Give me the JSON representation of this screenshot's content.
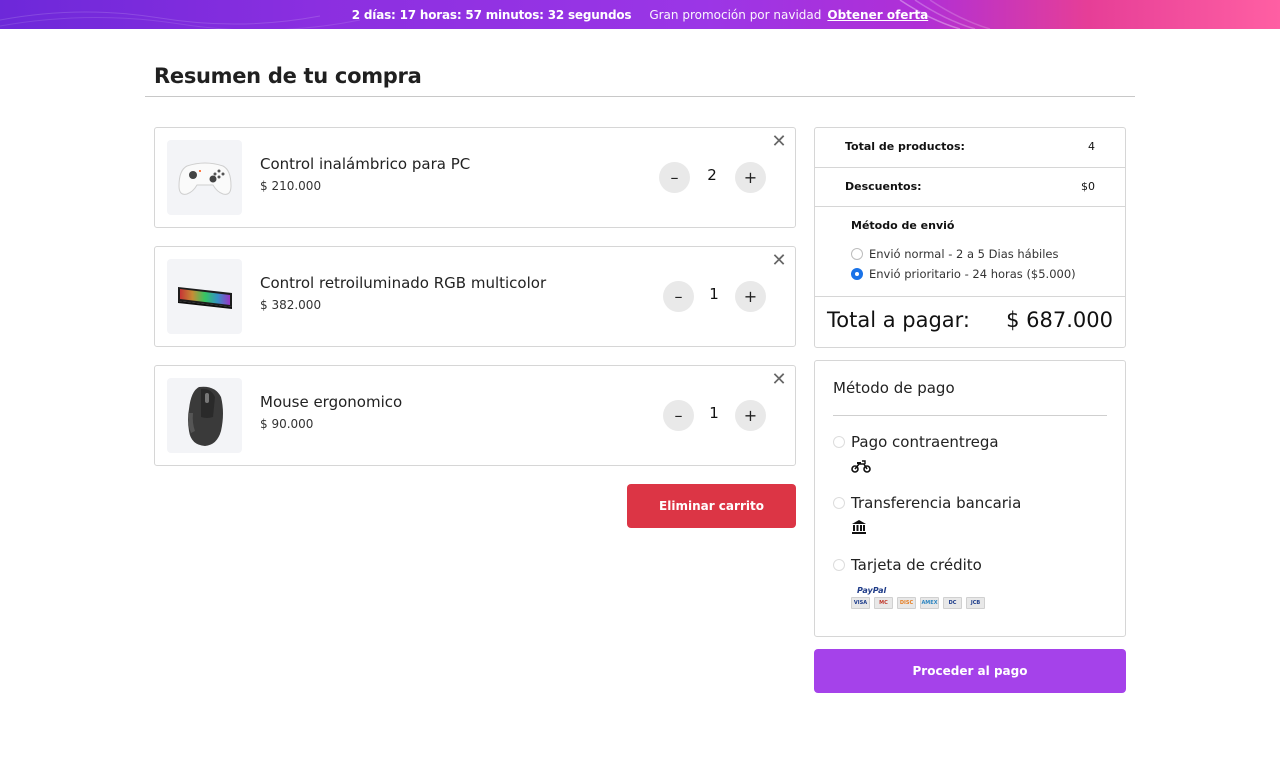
{
  "promo": {
    "countdown": "2 días: 17 horas: 57 minutos: 32 segundos",
    "message": "Gran promoción por navidad",
    "link_label": "Obtener oferta"
  },
  "page": {
    "title": "Resumen de tu compra"
  },
  "cart": {
    "items": [
      {
        "name": "Control inalámbrico para PC",
        "price": "$ 210.000",
        "quantity": "2",
        "image": "gamepad-image"
      },
      {
        "name": "Control retroiluminado RGB multicolor",
        "price": "$ 382.000",
        "quantity": "1",
        "image": "keyboard-image"
      },
      {
        "name": "Mouse ergonomico",
        "price": "$ 90.000",
        "quantity": "1",
        "image": "mouse-image"
      }
    ],
    "minus_symbol": "–",
    "plus_symbol": "+",
    "remove_symbol": "✕",
    "delete_label": "Eliminar carrito"
  },
  "summary": {
    "products_label": "Total de productos:",
    "products_value": "4",
    "discounts_label": "Descuentos:",
    "discounts_value": "$0",
    "shipping_title": "Método de envió",
    "shipping_options": [
      {
        "label": "Envió normal - 2 a 5 Dias hábiles",
        "selected": false
      },
      {
        "label": "Envió prioritario - 24 horas ($5.000)",
        "selected": true
      }
    ],
    "total_label": "Total a pagar:",
    "total_value": "$ 687.000"
  },
  "payment": {
    "title": "Método de pago",
    "options": [
      {
        "label": "Pago contraentrega",
        "icon": "motorcycle-icon"
      },
      {
        "label": "Transferencia bancaria",
        "icon": "bank-icon"
      },
      {
        "label": "Tarjeta de crédito",
        "icon": "credit-cards-icon"
      }
    ],
    "paypal_text": "PayPal",
    "card_brands": [
      "VISA",
      "MC",
      "DISC",
      "AMEX",
      "DC",
      "JCB"
    ],
    "proceed_label": "Proceder al pago"
  },
  "colors": {
    "delete_button": "#dc3545",
    "pay_button": "#a542ea",
    "radio_selected": "#1a73e8"
  }
}
